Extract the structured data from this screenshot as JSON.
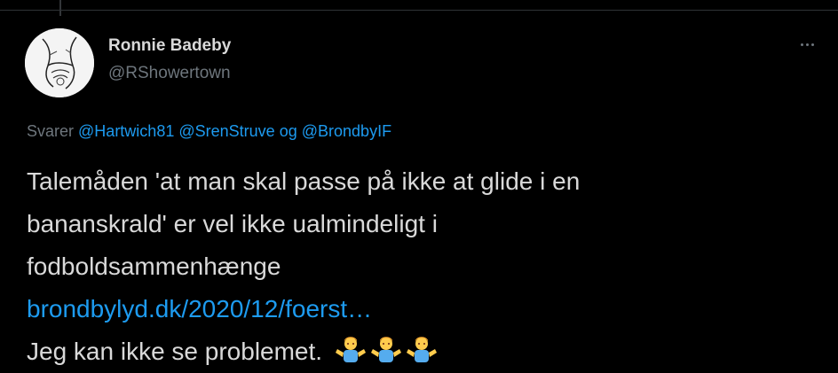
{
  "author": {
    "display_name": "Ronnie Badeby",
    "handle": "@RShowertown",
    "avatar_icon": "hands-sketch-avatar"
  },
  "reply": {
    "prefix": "Svarer",
    "mentions": [
      "@Hartwich81",
      "@SrenStruve",
      "@BrondbyIF"
    ],
    "connector": "og"
  },
  "tweet": {
    "lines": [
      "Talemåden 'at man skal passe på ikke at glide i en",
      "bananskrald' er vel ikke ualmindeligt i",
      "fodboldsammenhænge"
    ],
    "link": "brondbylyd.dk/2020/12/foerst…",
    "last_line": "Jeg kan ikke se problemet.",
    "emojis": [
      "shrug-emoji",
      "shrug-emoji",
      "shrug-emoji"
    ]
  },
  "more_icon": "ellipsis-icon",
  "colors": {
    "background": "#000000",
    "text": "#d9d9d9",
    "secondary": "#6e767d",
    "accent": "#1d9bf0"
  }
}
